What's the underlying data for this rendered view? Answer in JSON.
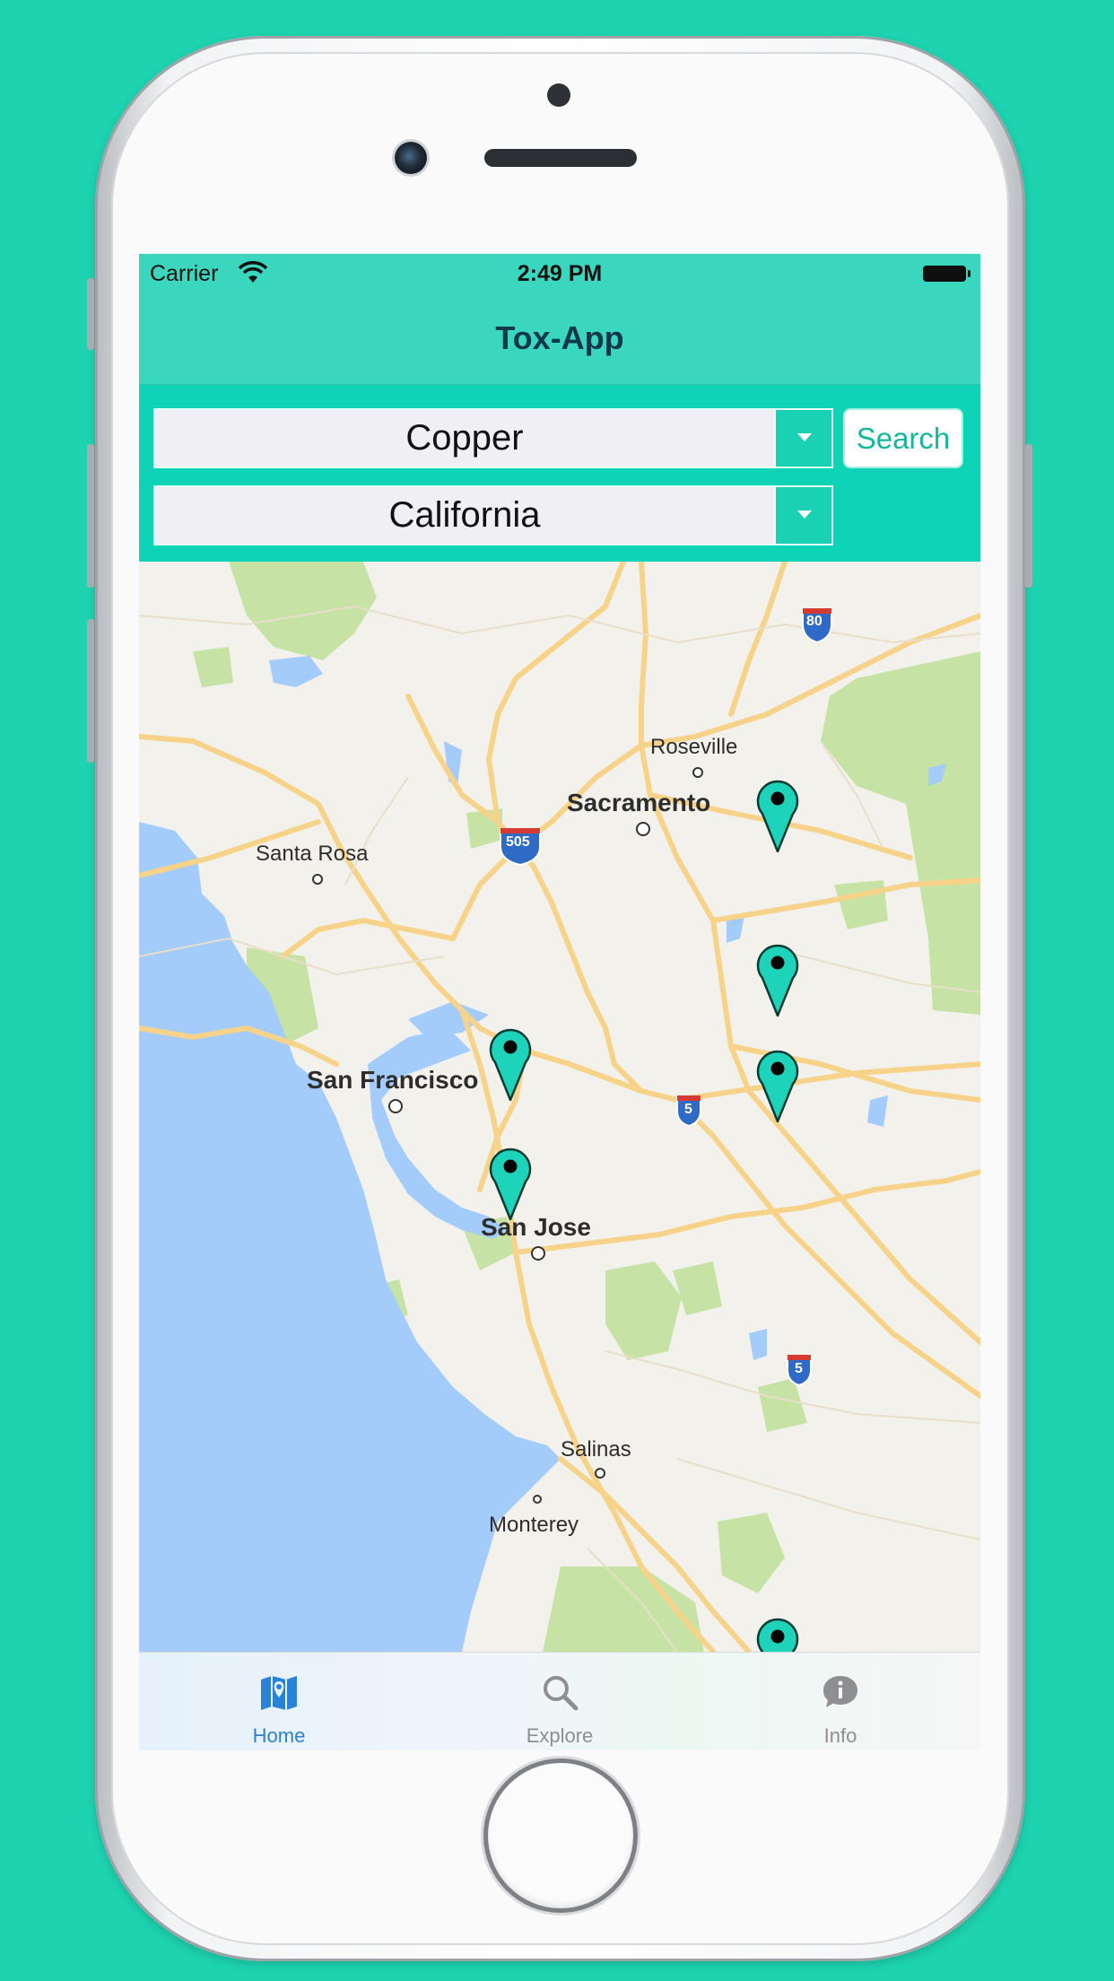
{
  "status_bar": {
    "carrier": "Carrier",
    "time": "2:49 PM"
  },
  "nav": {
    "title": "Tox-App"
  },
  "filters": {
    "metal": "Copper",
    "state": "California",
    "search_label": "Search"
  },
  "map": {
    "labels": {
      "roseville": "Roseville",
      "sacramento": "Sacramento",
      "santa_rosa": "Santa Rosa",
      "san_francisco": "San Francisco",
      "san_jose": "San Jose",
      "salinas": "Salinas",
      "monterey": "Monterey"
    },
    "shields": {
      "i80": "80",
      "i505": "505",
      "i5_a": "5",
      "i5_b": "5"
    },
    "marker_count": 7
  },
  "tabs": [
    {
      "label": "Home",
      "icon": "map-icon",
      "active": true
    },
    {
      "label": "Explore",
      "icon": "magnifier-icon",
      "active": false
    },
    {
      "label": "Info",
      "icon": "info-bubble-icon",
      "active": false
    }
  ],
  "colors": {
    "background": "#1dd3b0",
    "nav": "#3ad6bd",
    "filter_panel": "#0fd3b6",
    "marker": "#1dd3b9",
    "tab_active": "#2a82d6",
    "tab_inactive": "#8e8e93",
    "water": "#a3ccfb",
    "park": "#c6e3a5",
    "road": "#f7d38a"
  }
}
